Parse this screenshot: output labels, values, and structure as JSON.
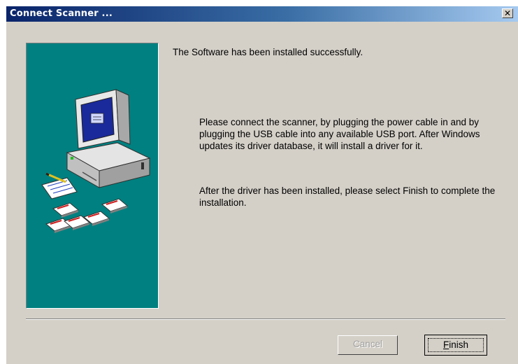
{
  "window": {
    "title": "Connect Scanner ...",
    "close_glyph": "✕"
  },
  "illustration": {
    "icon": "computer-with-disks-icon",
    "panel_color": "#008080"
  },
  "messages": {
    "main": "The Software has been installed successfully.",
    "connect": "Please connect the scanner, by plugging the power cable in and by plugging the USB cable into any available USB port. After Windows updates its driver database, it will install a driver for it.",
    "finish": "After the driver has been installed, please select Finish to complete the installation."
  },
  "buttons": {
    "cancel_label": "Cancel",
    "cancel_enabled": false,
    "finish_accel": "F",
    "finish_rest": "inish"
  },
  "colors": {
    "title_gradient_start": "#0a246a",
    "title_gradient_end": "#a6caf0",
    "dialog_face": "#d4d0c8"
  }
}
